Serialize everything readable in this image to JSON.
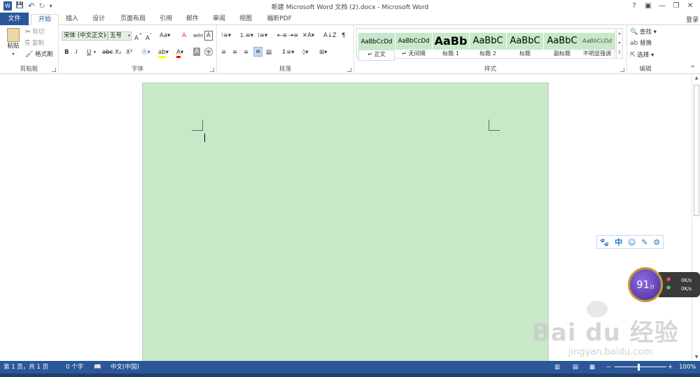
{
  "window": {
    "title": "新建 Microsoft Word 文档 (2).docx - Microsoft Word",
    "controls": [
      "?",
      "▣",
      "—",
      "❐",
      "✕"
    ]
  },
  "quick_access": [
    "W",
    "💾",
    "↶",
    "↻",
    "▾"
  ],
  "tabs": [
    "文件",
    "开始",
    "插入",
    "设计",
    "页面布局",
    "引用",
    "邮件",
    "审阅",
    "视图",
    "福昕PDF"
  ],
  "login": "登录",
  "clipboard": {
    "label": "剪贴板",
    "paste": "粘贴",
    "cut": "剪切",
    "copy": "复制",
    "format_painter": "格式刷"
  },
  "font": {
    "label": "字体",
    "family": "宋体 (中文正文)",
    "size": "五号",
    "bold": "B",
    "italic": "I",
    "underline": "U",
    "strike": "abc",
    "sub": "X₂",
    "sup": "X²"
  },
  "paragraph": {
    "label": "段落"
  },
  "styles": {
    "label": "样式",
    "items": [
      {
        "preview": "AaBbCcDd",
        "name": "↵ 正文"
      },
      {
        "preview": "AaBbCcDd",
        "name": "↵ 无间隔"
      },
      {
        "preview": "AaBb",
        "name": "标题 1"
      },
      {
        "preview": "AaBbC",
        "name": "标题 2"
      },
      {
        "preview": "AaBbC",
        "name": "标题"
      },
      {
        "preview": "AaBbC",
        "name": "副标题"
      },
      {
        "preview": "AaBbCcDd",
        "name": "不明显强调"
      }
    ]
  },
  "editing": {
    "label": "编辑",
    "find": "查找",
    "replace": "替换",
    "select": "选择"
  },
  "status": {
    "page": "第 1 页，共 1 页",
    "words": "0 个字",
    "language": "中文(中国)",
    "zoom": "100%"
  },
  "ime_toolbar": [
    "🐾",
    "中",
    "☺",
    "✎",
    "⚙"
  ],
  "speed_widget": {
    "score": "91",
    "unit": "分",
    "up": "0K/s",
    "down": "0K/s"
  },
  "watermark": {
    "brand": "Bai du 经验",
    "url": "jingyan.baidu.com"
  }
}
